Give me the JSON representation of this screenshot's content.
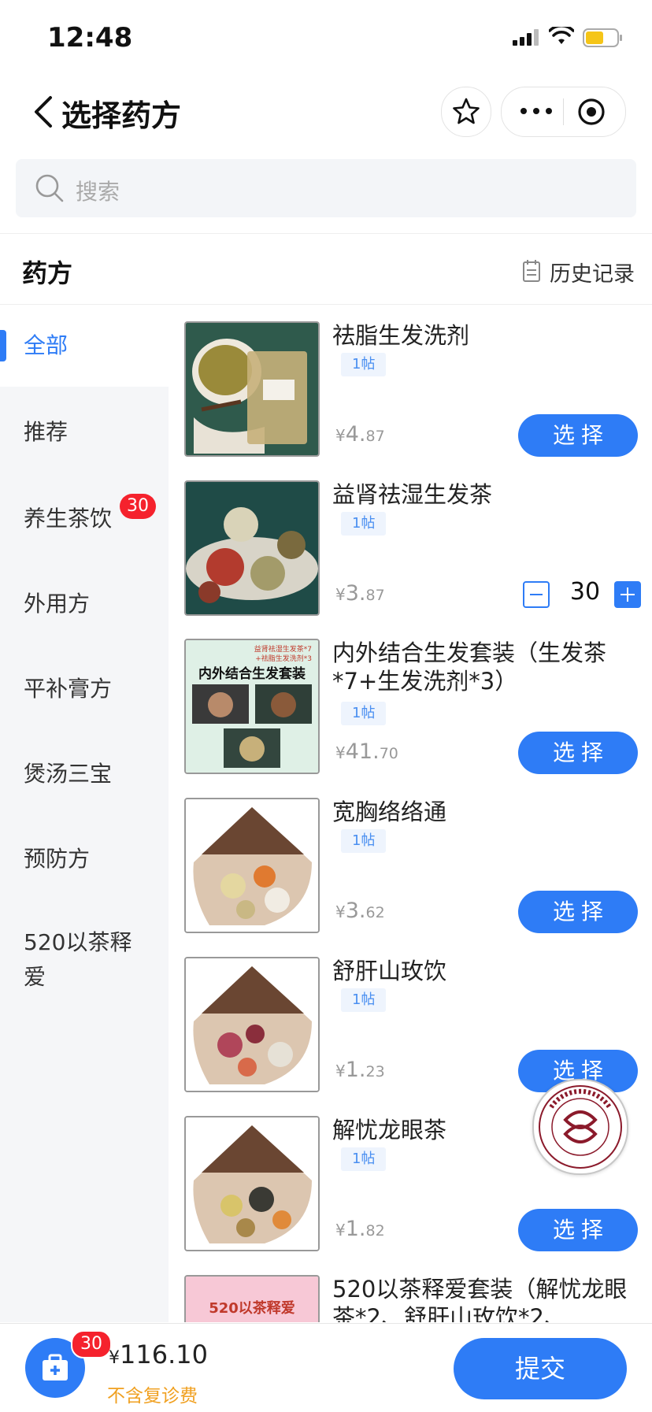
{
  "status_bar": {
    "time": "12:48"
  },
  "navbar": {
    "title": "选择药方"
  },
  "search": {
    "placeholder": "搜索"
  },
  "section": {
    "title": "药方",
    "history_label": "历史记录"
  },
  "sidebar": {
    "items": [
      {
        "label": "全部",
        "active": true
      },
      {
        "label": "推荐"
      },
      {
        "label": "养生茶饮",
        "badge": "30"
      },
      {
        "label": "外用方"
      },
      {
        "label": "平补膏方"
      },
      {
        "label": "煲汤三宝"
      },
      {
        "label": "预防方"
      },
      {
        "label": "520以茶释爱"
      }
    ]
  },
  "products": [
    {
      "name": "祛脂生发洗剂",
      "tag": "1帖",
      "price_yen": "¥",
      "price_int": "4.",
      "price_dec": "87",
      "action": "选择"
    },
    {
      "name": "益肾祛湿生发茶",
      "tag": "1帖",
      "price_yen": "¥",
      "price_int": "3.",
      "price_dec": "87",
      "quantity": "30"
    },
    {
      "name": "内外结合生发套装（生发茶*7+生发洗剂*3）",
      "tag": "1帖",
      "price_yen": "¥",
      "price_int": "41.",
      "price_dec": "70",
      "action": "选择",
      "image_text": {
        "title": "内外结合生发套装",
        "caption_line1": "益肾祛湿生发茶*7",
        "caption_line2": "+祛脂生发洗剂*3"
      }
    },
    {
      "name": "宽胸络络通",
      "tag": "1帖",
      "price_yen": "¥",
      "price_int": "3.",
      "price_dec": "62",
      "action": "选择"
    },
    {
      "name": "舒肝山玫饮",
      "tag": "1帖",
      "price_yen": "¥",
      "price_int": "1.",
      "price_dec": "23",
      "action": "选择"
    },
    {
      "name": "解忧龙眼茶",
      "tag": "1帖",
      "price_yen": "¥",
      "price_int": "1.",
      "price_dec": "82",
      "action": "选择"
    },
    {
      "name": "520以茶释爱套装（解忧龙眼茶*2、舒肝山玫饮*2、…",
      "image_text": {
        "title": "520以茶释爱"
      }
    }
  ],
  "logo": {
    "text": "浙江省中醫院 ZHEJIANG PROVINCIAL HOSPITAL OF CHINESE MEDICINE"
  },
  "bottom_bar": {
    "cart_badge": "30",
    "total_yen": "¥",
    "total_value": "116.10",
    "fee_note": "不含复诊费",
    "submit_label": "提交"
  },
  "colors": {
    "primary": "#2e7cf6",
    "badge": "#f5222d",
    "fee_note": "#f0a020"
  },
  "icons": [
    "chevron-left-icon",
    "star-icon",
    "more-dots-icon",
    "record-icon",
    "search-icon",
    "calendar-icon",
    "medicine-box-icon"
  ]
}
